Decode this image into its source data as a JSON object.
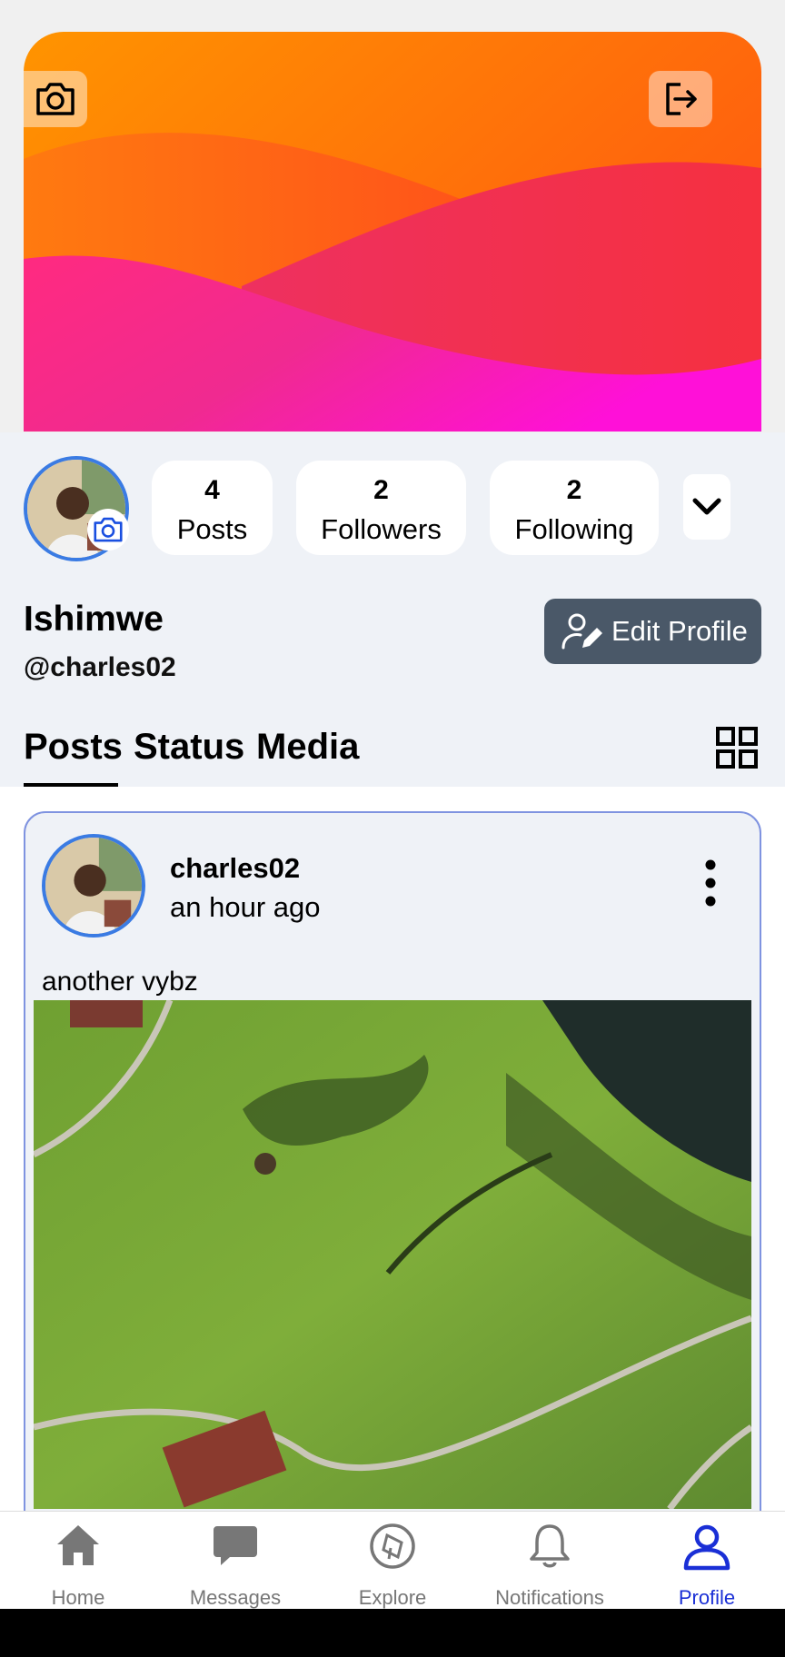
{
  "colors": {
    "accent": "#3a7be3",
    "active_nav": "#1a2fd6",
    "edit_button": "#4a5868",
    "card_border": "#7f93e0",
    "cover_gradient": [
      "#ff9a00",
      "#ff3d3d",
      "#ff10d0"
    ]
  },
  "cover": {
    "camera_icon": "camera-icon",
    "logout_icon": "logout-icon"
  },
  "stats": [
    {
      "value": "4",
      "label": "Posts"
    },
    {
      "value": "2",
      "label": "Followers"
    },
    {
      "value": "2",
      "label": "Following"
    }
  ],
  "profile": {
    "name": "Ishimwe",
    "handle": "@charles02",
    "edit_label": "Edit Profile"
  },
  "tabs": [
    {
      "label": "Posts",
      "active": true
    },
    {
      "label": "Status",
      "active": false
    },
    {
      "label": "Media",
      "active": false
    }
  ],
  "post": {
    "username": "charles02",
    "time": "an hour ago",
    "text": "another vybz"
  },
  "nav": [
    {
      "label": "Home",
      "icon": "home-icon"
    },
    {
      "label": "Messages",
      "icon": "chat-icon"
    },
    {
      "label": "Explore",
      "icon": "compass-icon"
    },
    {
      "label": "Notifications",
      "icon": "bell-icon"
    },
    {
      "label": "Profile",
      "icon": "user-icon",
      "active": true
    }
  ]
}
